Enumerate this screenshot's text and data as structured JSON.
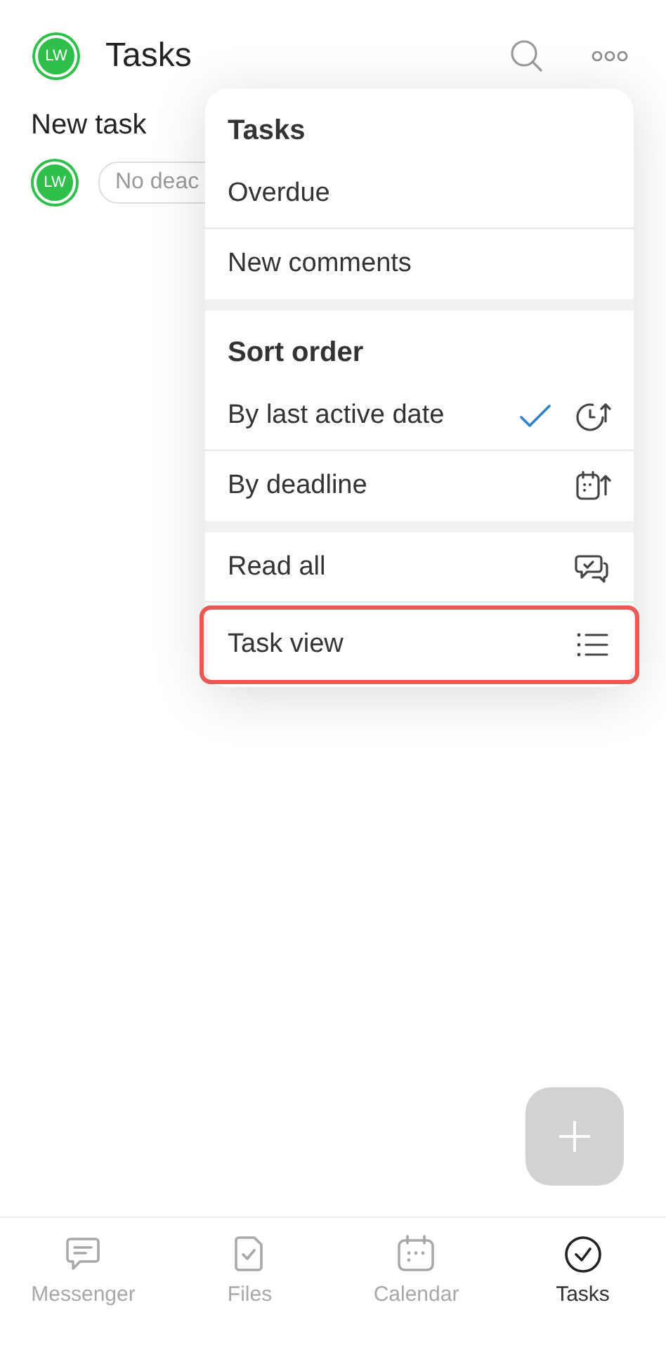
{
  "header": {
    "avatar": "LW",
    "title": "Tasks"
  },
  "tasks": [
    {
      "title": "New task",
      "avatar": "LW",
      "deadline": "No deac"
    }
  ],
  "menu": {
    "sections": [
      {
        "title": "Tasks",
        "items": [
          {
            "label": "Overdue"
          },
          {
            "label": "New comments"
          }
        ]
      },
      {
        "title": "Sort order",
        "items": [
          {
            "label": "By last active date",
            "checked": true
          },
          {
            "label": "By deadline",
            "checked": false
          }
        ]
      },
      {
        "items": [
          {
            "label": "Read all",
            "highlighted": false
          },
          {
            "label": "Task view",
            "highlighted": true
          }
        ]
      }
    ]
  },
  "tab_bar": [
    {
      "label": "Messenger",
      "selected": false
    },
    {
      "label": "Files",
      "selected": false
    },
    {
      "label": "Calendar",
      "selected": false
    },
    {
      "label": "Tasks",
      "selected": true
    }
  ]
}
